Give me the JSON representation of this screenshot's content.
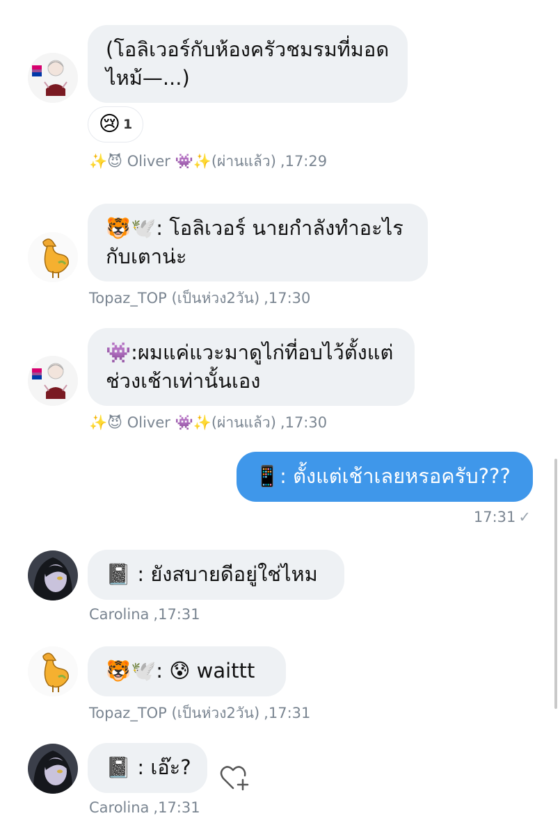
{
  "messages": [
    {
      "sender": "Oliver",
      "text_lines": [
        "(โอลิเวอร์กับห้องครัวชมรมที่มอด",
        "ไหม้—...)"
      ],
      "reaction": {
        "emoji": "😢",
        "count": "1"
      },
      "meta_name": "✨😈 Oliver 👾✨(ผ่านแล้ว)",
      "time": ",17:29",
      "avatar_icon": "bisexual-flag-girl-avatar"
    },
    {
      "sender": "Topaz_TOP",
      "text_lines": [
        "🐯🕊️: โอลิเวอร์ นายกำลังทำอะไร",
        "กับเตาน่ะ"
      ],
      "meta_name": "Topaz_TOP (เป็นห่วง2วัน)",
      "time": ",17:30",
      "avatar_icon": "yellow-duck-avatar"
    },
    {
      "sender": "Oliver",
      "text_lines": [
        "👾:ผมแค่แวะมาดูไก่ที่อบไว้ตั้งแต่",
        "ช่วงเช้าเท่านั้นเอง"
      ],
      "meta_name": "✨😈 Oliver 👾✨(ผ่านแล้ว)",
      "time": ",17:30",
      "avatar_icon": "bisexual-flag-girl-avatar"
    },
    {
      "sender": "me",
      "text_lines": [
        "📱: ตั้งแต่เช้าเลยหรอครับ???"
      ],
      "time": "17:31",
      "check": "✓"
    },
    {
      "sender": "Carolina",
      "text_lines": [
        "📓 : ยังสบายดีอยู่ใช่ไหม"
      ],
      "meta_name": "Carolina",
      "time": ",17:31",
      "avatar_icon": "dark-hair-girl-avatar"
    },
    {
      "sender": "Topaz_TOP",
      "text_lines": [
        "🐯🕊️: 😰 waittt"
      ],
      "meta_name": "Topaz_TOP (เป็นห่วง2วัน)",
      "time": ",17:31",
      "avatar_icon": "yellow-duck-avatar"
    },
    {
      "sender": "Carolina",
      "text_lines": [
        "📓 : เอ๊ะ?"
      ],
      "meta_name": "Carolina",
      "time": ",17:31",
      "avatar_icon": "dark-hair-girl-avatar",
      "action_icon": "heart-plus-icon"
    }
  ],
  "colors": {
    "bubble_in": "#eef1f4",
    "bubble_out": "#3f97ea",
    "meta": "#7a8591"
  }
}
